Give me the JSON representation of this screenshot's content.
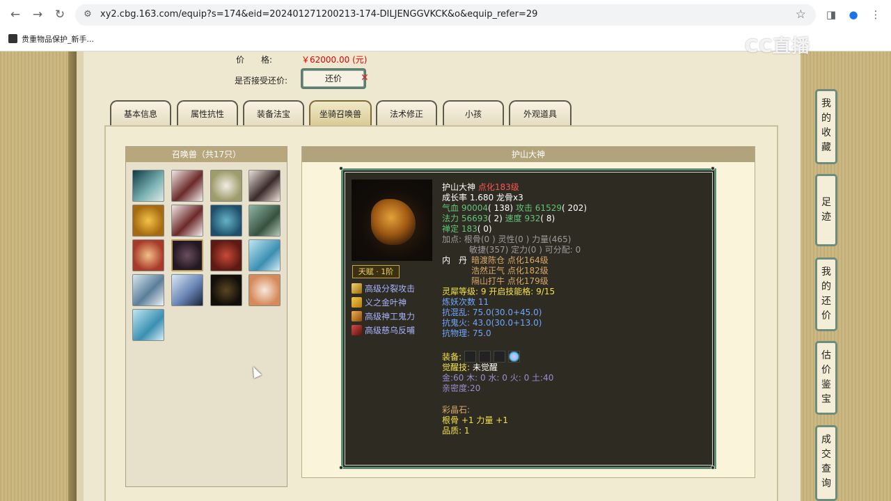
{
  "browser": {
    "url": "xy2.cbg.163.com/equip?s=174&eid=202401271200213-174-DILJENGGVKCK&o&equip_refer=29",
    "bookmark": "贵重物品保护_新手...",
    "watermark": "CC直播"
  },
  "price": {
    "label": "价　　格:",
    "value": "￥62000.00 (元)",
    "counter_label": "是否接受还价:",
    "counter_button": "还价"
  },
  "tabs": [
    "基本信息",
    "属性抗性",
    "装备法宝",
    "坐骑召唤兽",
    "法术修正",
    "小孩",
    "外观道具"
  ],
  "active_tab": "坐骑召唤兽",
  "pets": {
    "title": "召唤兽（共17只）",
    "count": 17
  },
  "detail": {
    "title": "护山大神",
    "name": "护山大神",
    "dianhua": "点化183级",
    "growth": "成长率 1.680 龙骨x3",
    "hp_label": "气血",
    "hp": "90004",
    "hp_extra": "( 138)",
    "atk_label": "攻击",
    "atk": "61529",
    "atk_extra": "( 202)",
    "mp_label": "法力",
    "mp": "56693",
    "mp_extra": "( 2)",
    "spd_label": "速度",
    "spd": "932",
    "spd_extra": "( 8)",
    "calm_label": "禅定",
    "calm": "183",
    "calm_extra": "( 0)",
    "points1": "加点:  根骨(0 ) 灵性(0 ) 力量(465)",
    "points2": "敏捷(357) 定力(0 ) 可分配:  0",
    "neidan_label": "内　丹",
    "neidan1": "暗渡陈仓 点化164级",
    "neidan2": "浩然正气 点化182级",
    "neidan3": "隔山打牛 点化179级",
    "lingxi": "灵犀等级:  9 开启技能格:  9/15",
    "lianyao": "炼妖次数 11",
    "res1": "抗混乱: 75.0(30.0+45.0)",
    "res2": "抗鬼火: 43.0(30.0+13.0)",
    "res3": "抗物理: 75.0",
    "equip_label": "装备:",
    "awaken_label": "觉醒技:",
    "awaken_value": "未觉醒",
    "elements": "金:60 木: 0 水: 0 火: 0 土:40",
    "intimacy": "亲密度:20",
    "crystal_label": "彩晶石:",
    "crystal_value": "根骨 +1 力量 +1",
    "quality": "品质:  1",
    "talent": "天赋 · 1阶",
    "skills": [
      "高级分裂攻击",
      "义之金叶神",
      "高级神工鬼力",
      "高级慈乌反哺"
    ]
  },
  "side_buttons": [
    "我的收藏",
    "足迹",
    "我的还价",
    "估价鉴宝",
    "成交查询"
  ],
  "colors": {
    "accent_green": "#5e8b73",
    "price_red": "#dd0000",
    "panel_dark": "#2e2b22",
    "skill_blue": "#a8b4ff"
  }
}
